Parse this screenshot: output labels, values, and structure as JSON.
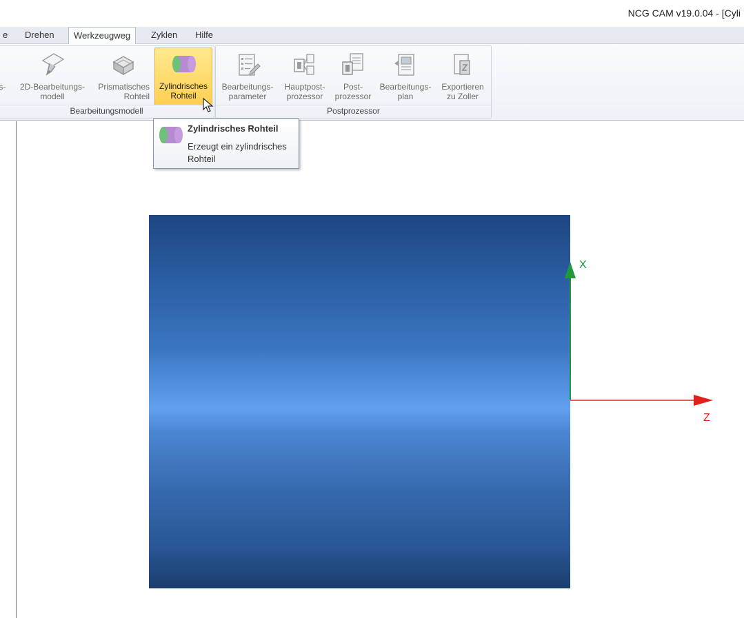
{
  "window": {
    "title": "NCG CAM v19.0.04 - [Cyli"
  },
  "menu": {
    "items": [
      {
        "label": "e"
      },
      {
        "label": "Drehen"
      },
      {
        "label": "Werkzeugweg"
      },
      {
        "label": "Zyklen"
      },
      {
        "label": "Hilfe"
      }
    ]
  },
  "ribbon": {
    "groups": [
      {
        "label": "Bearbeitungsmodell",
        "buttons": [
          {
            "line1": "2D-Bearbeitungs-",
            "line2": "modell",
            "icon": "lathe-tool-icon"
          },
          {
            "line1": "Prismatisches",
            "line2": "Rohteil",
            "icon": "prismatic-stock-icon"
          },
          {
            "line1": "Zylindrisches",
            "line2": "Rohteil",
            "icon": "cylinder-stock-icon"
          }
        ],
        "cut_prefix": "ıs-"
      },
      {
        "label": "Postprozessor",
        "buttons": [
          {
            "line1": "Bearbeitungs-",
            "line2": "parameter",
            "icon": "parameter-sheet-icon"
          },
          {
            "line1": "Hauptpost-",
            "line2": "prozessor",
            "icon": "main-postprocessor-icon"
          },
          {
            "line1": "Post-",
            "line2": "prozessor",
            "icon": "postprocessor-icon"
          },
          {
            "line1": "Bearbeitungs-",
            "line2": "plan",
            "icon": "machining-plan-icon"
          },
          {
            "line1": "Exportieren",
            "line2": "zu Zoller",
            "icon": "export-zoller-icon"
          }
        ]
      }
    ]
  },
  "tooltip": {
    "title": "Zylindrisches Rohteil",
    "description": "Erzeugt ein zylindrisches Rohteil",
    "icon": "cylinder-stock-icon"
  },
  "viewport": {
    "x_axis_label": "X",
    "z_axis_label": "Z",
    "colors": {
      "x_axis": "#1e9a3c",
      "z_axis": "#e0201b",
      "stock_top": "#1d4680",
      "stock_highlight": "#61a0ef",
      "stock_bottom": "#1b3d6e"
    }
  }
}
